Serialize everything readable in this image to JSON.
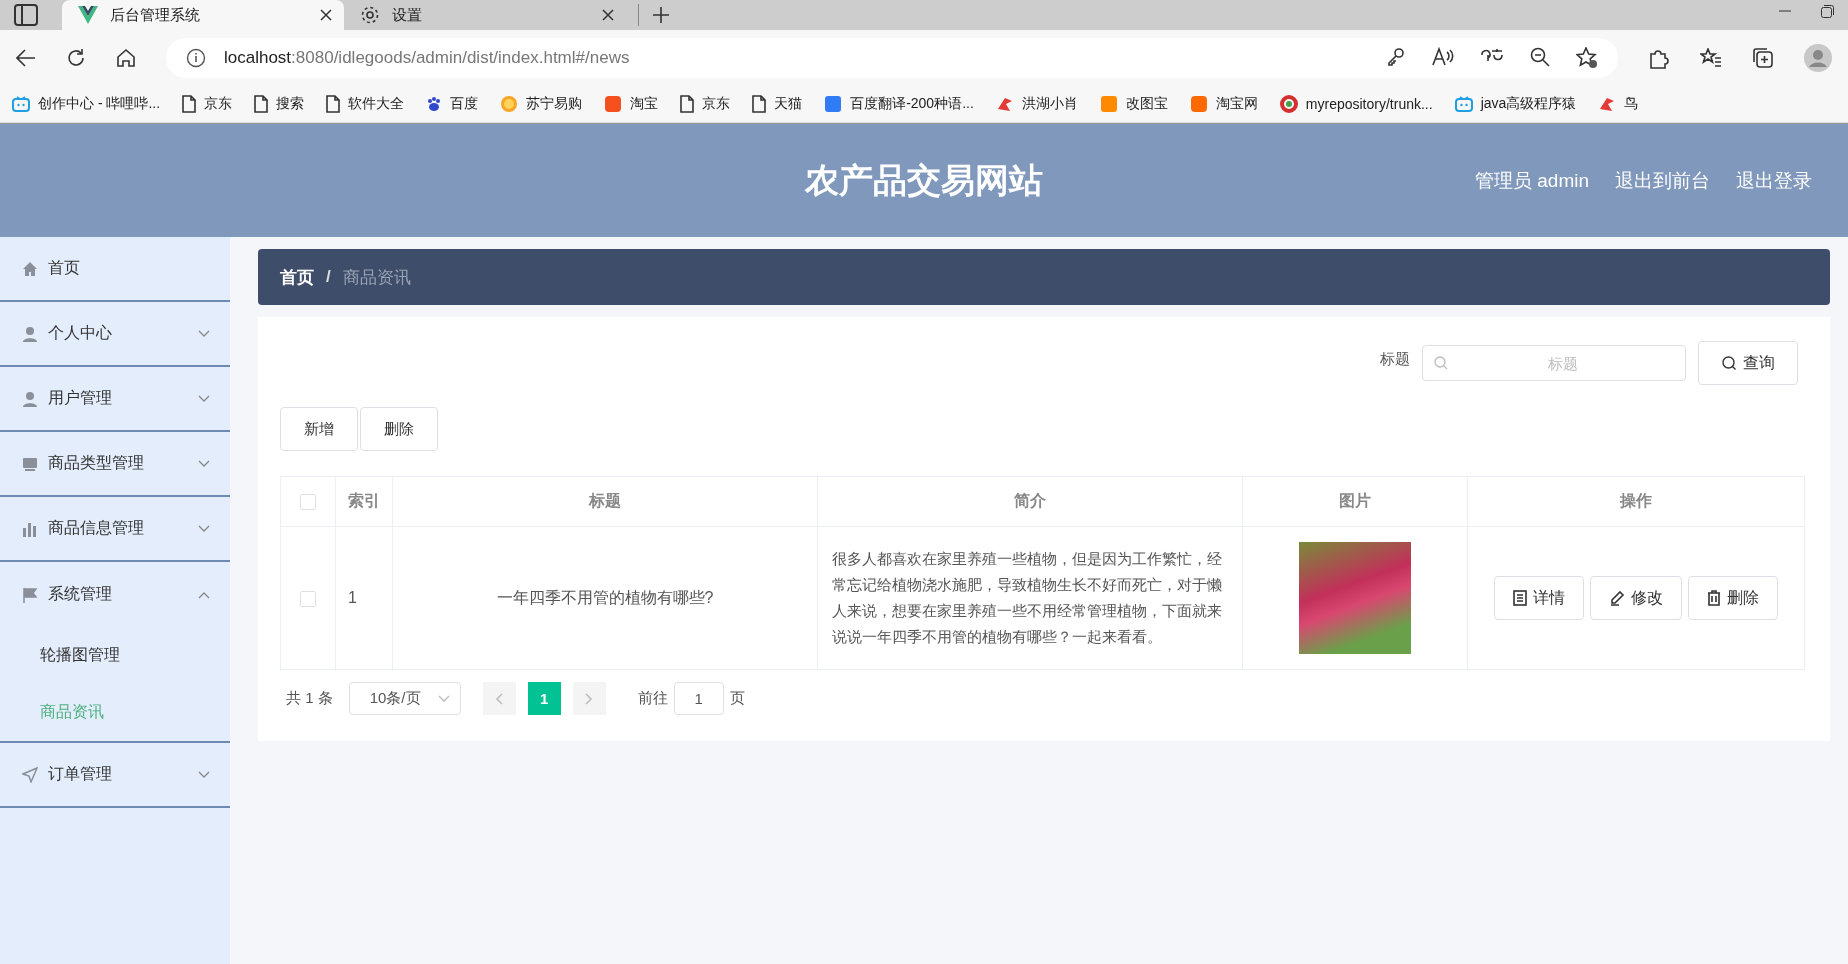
{
  "browser": {
    "tabs": [
      {
        "title": "后台管理系统",
        "kind": "vue",
        "selected": true
      },
      {
        "title": "设置",
        "kind": "gear",
        "selected": false
      }
    ],
    "address": {
      "host": "localhost",
      "path": ":8080/idlegoods/admin/dist/index.html#/news"
    },
    "bookmarks": [
      {
        "label": "创作中心 - 哔哩哔...",
        "kind": "tv"
      },
      {
        "label": "京东",
        "kind": "page"
      },
      {
        "label": "搜索",
        "kind": "page"
      },
      {
        "label": "软件大全",
        "kind": "page"
      },
      {
        "label": "百度",
        "kind": "paw"
      },
      {
        "label": "苏宁易购",
        "kind": "sun"
      },
      {
        "label": "淘宝",
        "kind": "tao",
        "color": "#f4511e"
      },
      {
        "label": "京东",
        "kind": "page"
      },
      {
        "label": "天猫",
        "kind": "page"
      },
      {
        "label": "百度翻译-200种语...",
        "kind": "tile",
        "color": "#2f7cf6"
      },
      {
        "label": "洪湖小肖",
        "kind": "bird"
      },
      {
        "label": "改图宝",
        "kind": "tile",
        "color": "#ff8a00"
      },
      {
        "label": "淘宝网",
        "kind": "tao",
        "color": "#ff6a00"
      },
      {
        "label": "myrepository/trunk...",
        "kind": "ring"
      },
      {
        "label": "java高级程序猿",
        "kind": "tv"
      },
      {
        "label": "鸟",
        "kind": "bird"
      }
    ]
  },
  "header": {
    "title": "农产品交易网站",
    "links": [
      "管理员 admin",
      "退出到前台",
      "退出登录"
    ]
  },
  "sidebar": {
    "items": [
      {
        "label": "首页",
        "kind": "home"
      },
      {
        "label": "个人中心",
        "kind": "user",
        "expanded": false
      },
      {
        "label": "用户管理",
        "kind": "user",
        "expanded": false
      },
      {
        "label": "商品类型管理",
        "kind": "box",
        "expanded": false
      },
      {
        "label": "商品信息管理",
        "kind": "chart",
        "expanded": false
      },
      {
        "label": "系统管理",
        "kind": "flag",
        "expanded": true,
        "children": [
          {
            "label": "轮播图管理",
            "selected": false
          },
          {
            "label": "商品资讯",
            "selected": true
          }
        ]
      },
      {
        "label": "订单管理",
        "kind": "send",
        "expanded": false
      }
    ]
  },
  "breadcrumb": {
    "items": [
      "首页",
      "商品资讯"
    ],
    "separator": "/"
  },
  "search": {
    "label": "标题",
    "placeholder": "标题",
    "button": "查询"
  },
  "actions": [
    "新增",
    "删除"
  ],
  "table": {
    "columns": [
      "索引",
      "标题",
      "简介",
      "图片",
      "操作"
    ],
    "all_checked": false,
    "rows": [
      {
        "checked": false,
        "index": "1",
        "title": "一年四季不用管的植物有哪些?",
        "summary": "很多人都喜欢在家里养殖一些植物，但是因为工作繁忙，经常忘记给植物浇水施肥，导致植物生长不好而死亡，对于懒人来说，想要在家里养殖一些不用经常管理植物，下面就来说说一年四季不用管的植物有哪些？一起来看看。",
        "buttons": [
          {
            "label": "详情",
            "kind": "doc"
          },
          {
            "label": "修改",
            "kind": "pen"
          },
          {
            "label": "删除",
            "kind": "trash"
          }
        ]
      }
    ]
  },
  "pagination": {
    "total": "共 1 条",
    "page_size": "10条/页",
    "pages": [
      {
        "label": "1",
        "selected": true
      }
    ],
    "goto_label": "前往",
    "goto_value": "1",
    "suffix": "页"
  }
}
